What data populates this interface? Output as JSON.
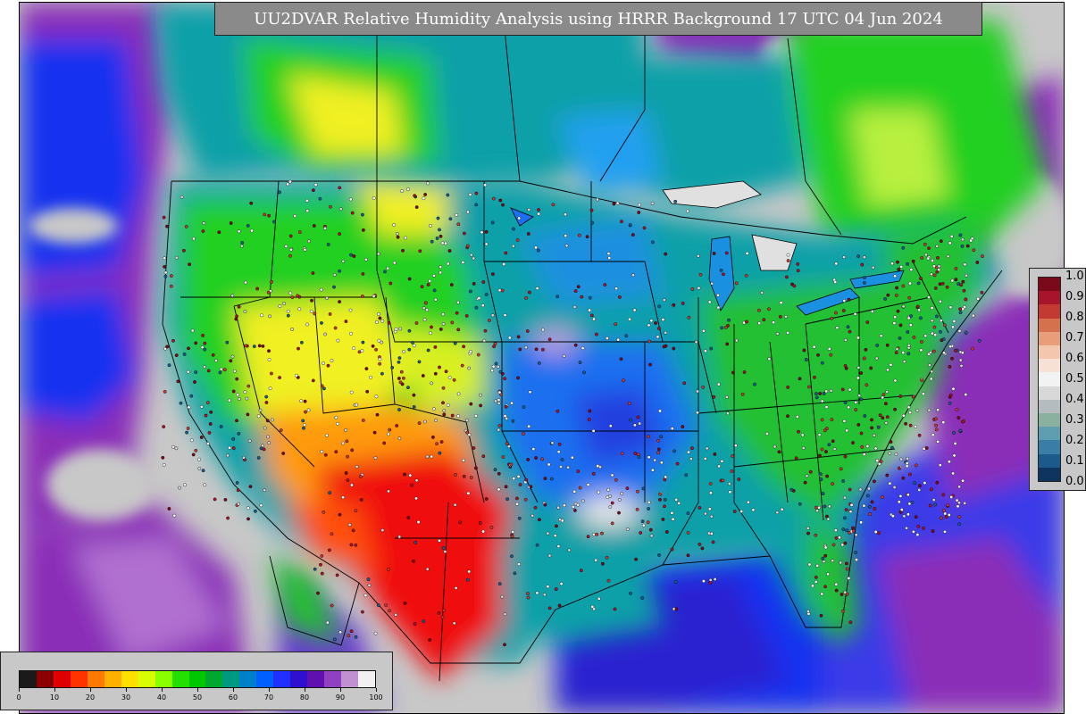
{
  "title": "UU2DVAR Relative Humidity Analysis using HRRR Background 17 UTC 04 Jun 2024",
  "rh_colorbar": {
    "ticks": [
      "0",
      "10",
      "20",
      "30",
      "40",
      "50",
      "60",
      "70",
      "80",
      "90",
      "100"
    ],
    "colors": [
      "#1a1a1a",
      "#8b0000",
      "#e00000",
      "#ff3300",
      "#ff7a00",
      "#ffb000",
      "#ffe000",
      "#d8ff00",
      "#8aff00",
      "#22e000",
      "#00c800",
      "#00a830",
      "#009a80",
      "#0080c8",
      "#0060ff",
      "#2030ff",
      "#3010d0",
      "#6010b0",
      "#9040c0",
      "#c090d0",
      "#f0f0f0"
    ]
  },
  "station_colorbar": {
    "ticks": [
      "1.0",
      "0.9",
      "0.8",
      "0.7",
      "0.6",
      "0.5",
      "0.4",
      "0.3",
      "0.2",
      "0.1",
      "0.0"
    ],
    "colors": [
      "#7a0a1a",
      "#a8152a",
      "#c23a32",
      "#d6714e",
      "#e89e78",
      "#f4c6ae",
      "#f7e0d4",
      "#f2f2f2",
      "#d8d8d8",
      "#b4bcc0",
      "#8ab0a0",
      "#5e9eb0",
      "#3a7ea8",
      "#1d5a8c",
      "#0d3560"
    ]
  },
  "map": {
    "region": "CONUS",
    "colors": {
      "ocean_dry": "#c8c8c8",
      "ocean_purple": "#8a2fb8",
      "ocean_blue": "#1830f0",
      "humid_teal": "#0aa0a8",
      "mid_green": "#20d020",
      "yellow": "#f0f020",
      "orange": "#ff9a10",
      "red": "#f01010",
      "borders": "#000000"
    }
  }
}
